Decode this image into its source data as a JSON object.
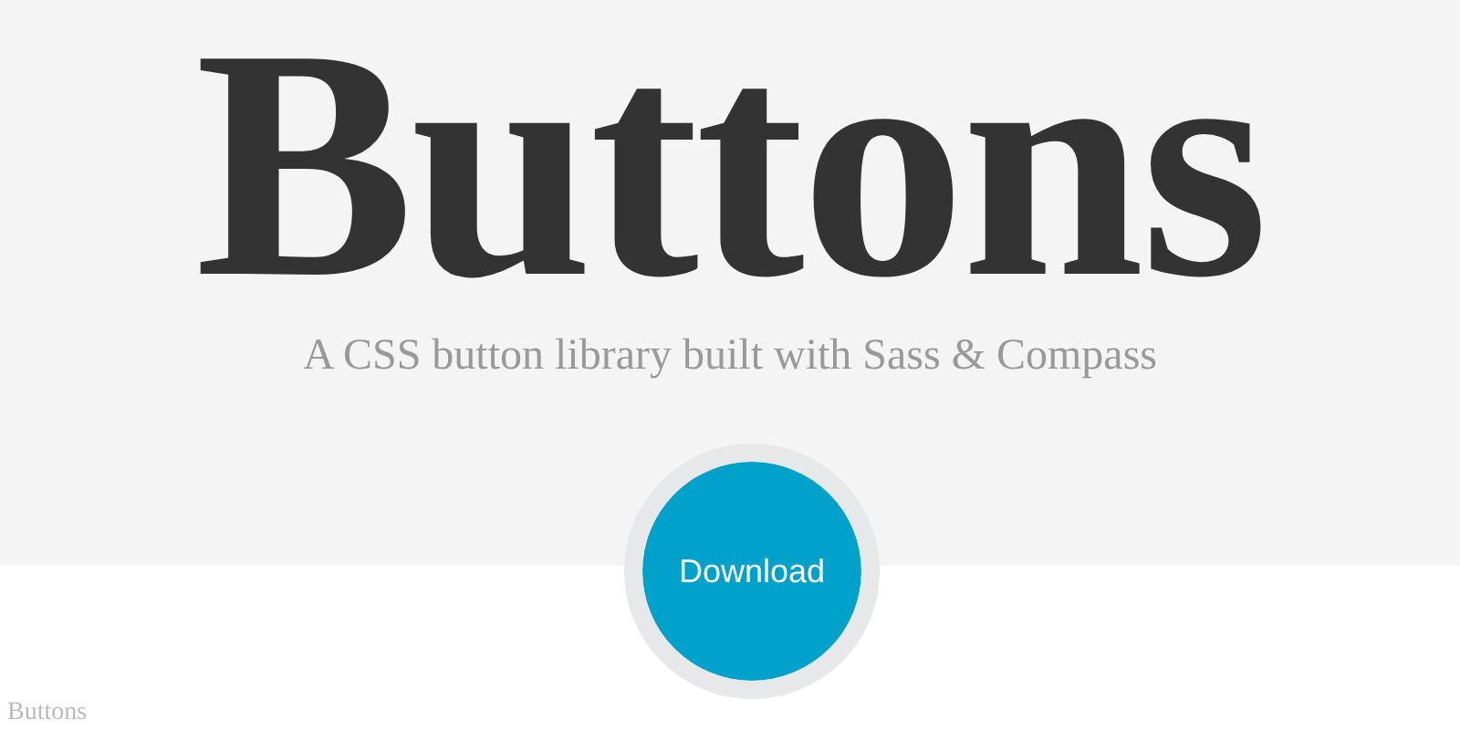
{
  "header": {
    "title": "Buttons",
    "subtitle": "A CSS button library built with Sass & Compass"
  },
  "download_button": {
    "label": "Download"
  },
  "footer": {
    "logo_text": "Buttons"
  }
}
